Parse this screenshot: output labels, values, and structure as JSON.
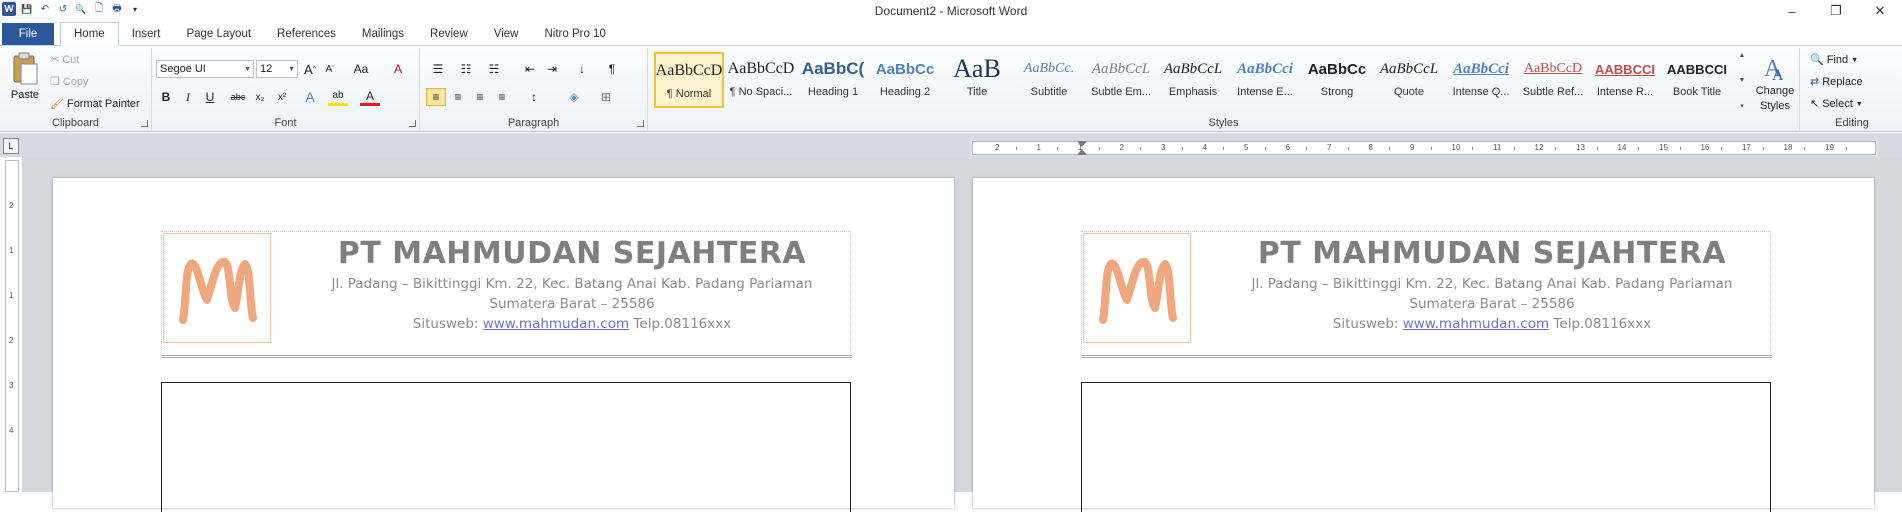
{
  "window": {
    "title": "Document2 - Microsoft Word",
    "minimize": "–",
    "restore": "❐",
    "close": "✕"
  },
  "qat": {
    "word_icon": "W",
    "save": "💾",
    "undo": "↶",
    "redo": "↺",
    "print_preview": "🔍",
    "new": "🗋",
    "quick_print": "🖶",
    "customize": "▾"
  },
  "tabs": [
    {
      "label": "File"
    },
    {
      "label": "Home"
    },
    {
      "label": "Insert"
    },
    {
      "label": "Page Layout"
    },
    {
      "label": "References"
    },
    {
      "label": "Mailings"
    },
    {
      "label": "Review"
    },
    {
      "label": "View"
    },
    {
      "label": "Nitro Pro 10"
    }
  ],
  "clipboard": {
    "label": "Clipboard",
    "paste": "Paste",
    "cut": "Cut",
    "copy": "Copy",
    "format_painter": "Format Painter"
  },
  "font": {
    "label": "Font",
    "family": "Segoe UI",
    "size": "12",
    "grow": "A",
    "shrink": "A",
    "change_case": "Aa",
    "clear": "A",
    "bold": "B",
    "italic": "I",
    "underline": "U",
    "strike": "abc",
    "sub": "x₂",
    "sup": "x²",
    "effects": "A",
    "highlight": "ab",
    "color": "A"
  },
  "paragraph": {
    "label": "Paragraph",
    "bullets": "☰",
    "numbering": "☷",
    "multilevel": "☵",
    "dec_indent": "⇤",
    "inc_indent": "⇥",
    "sort": "↓",
    "pilcrow": "¶",
    "align_left": "≡",
    "center": "≡",
    "align_right": "≡",
    "justify": "≡",
    "spacing": "↕",
    "shading": "◈",
    "borders": "⊞"
  },
  "styles": {
    "label": "Styles",
    "items": [
      {
        "preview": "AaBbCcD",
        "name": "¶ Normal"
      },
      {
        "preview": "AaBbCcD",
        "name": "¶ No Spaci..."
      },
      {
        "preview": "AaBbC(",
        "name": "Heading 1"
      },
      {
        "preview": "AaBbCc",
        "name": "Heading 2"
      },
      {
        "preview": "AaB",
        "name": "Title"
      },
      {
        "preview": "AaBbCc.",
        "name": "Subtitle"
      },
      {
        "preview": "AaBbCcL",
        "name": "Subtle Em..."
      },
      {
        "preview": "AaBbCcL",
        "name": "Emphasis"
      },
      {
        "preview": "AaBbCci",
        "name": "Intense E..."
      },
      {
        "preview": "AaBbCc",
        "name": "Strong"
      },
      {
        "preview": "AaBbCcL",
        "name": "Quote"
      },
      {
        "preview": "AaBbCci",
        "name": "Intense Q..."
      },
      {
        "preview": "AaBbCcD",
        "name": "Subtle Ref..."
      },
      {
        "preview": "AABBCCI",
        "name": "Intense R..."
      },
      {
        "preview": "AABBCCI",
        "name": "Book Title"
      }
    ],
    "change_styles": "Change Styles",
    "change_styles_line1": "Change",
    "change_styles_line2": "Styles"
  },
  "editing": {
    "label": "Editing",
    "find": "Find",
    "replace": "Replace",
    "select": "Select"
  },
  "ruler": {
    "tab_selector": "L",
    "h_numbers": [
      "2",
      "1",
      "1",
      "2",
      "3",
      "4",
      "5",
      "6",
      "7",
      "8",
      "9",
      "10",
      "11",
      "12",
      "13",
      "14",
      "15",
      "16",
      "17",
      "18",
      "19"
    ],
    "v_numbers": [
      "2",
      "1",
      "1",
      "2",
      "3",
      "4"
    ]
  },
  "document": {
    "company": "PT MAHMUDAN SEJAHTERA",
    "address1": "Jl. Padang – Bikittinggi Km. 22, Kec. Batang Anai  Kab. Padang Pariaman",
    "address2": "Sumatera Barat – 25586",
    "site_label": "Situsweb: ",
    "site_url": "www.mahmudan.com",
    "phone": "  Telp.08116xxx",
    "logo_letter": "M"
  },
  "colors": {
    "file_tab": "#2b579a",
    "logo_stroke": "#f0a77d",
    "link": "#6a73c7"
  }
}
